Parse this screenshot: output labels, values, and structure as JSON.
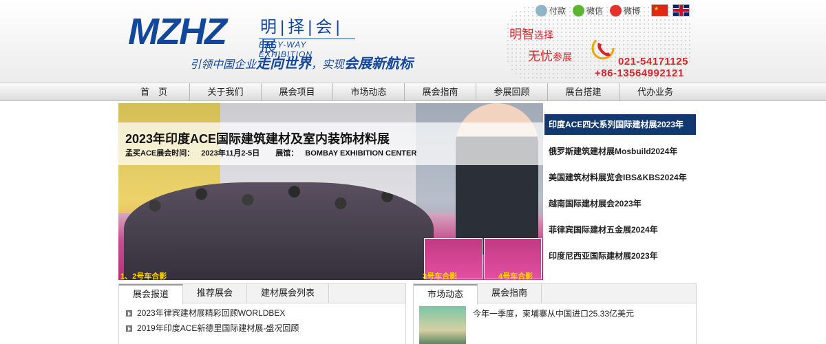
{
  "brand": {
    "logo_mark": "MZHZ",
    "logo_cn": "明|择|会|展",
    "logo_en": "EASY-WAY EXHIBITION",
    "slogan_prefix": "引领中国企业",
    "slogan_emph1": "走向世界",
    "slogan_mid": "，实现",
    "slogan_emph2": "会展新航标"
  },
  "top_links": {
    "pay": "付款",
    "wechat": "微信",
    "weibo": "微博"
  },
  "tagline": {
    "line1_big": "明智",
    "line1_small": "选择",
    "line2_big": "无忧",
    "line2_small": "参展"
  },
  "contact": {
    "phone1": "021-54171125",
    "phone2": "+86-13564992121"
  },
  "nav": [
    "首　页",
    "关于我们",
    "展会项目",
    "市场动态",
    "展会指南",
    "参展回顾",
    "展台搭建",
    "代办业务"
  ],
  "banner": {
    "title": "2023年印度ACE国际建筑建材及室内装饰材料展",
    "time_label": "孟买ACE展会时间：",
    "time_value": "2023年11月2-5日",
    "venue_label": "展馆：",
    "venue_value": "BOMBAY EXHIBITION CENTER",
    "caption1": "1、2号车合影",
    "caption2": "3号车合影",
    "caption3": "4号车合影"
  },
  "expo_list": [
    "印度ACE四大系列国际建材展2023年",
    "俄罗斯建筑建材展Mosbuild2024年",
    "美国建筑材料展览会IBS&KBS2024年",
    "越南国际建材展会2023年",
    "菲律宾国际建材五金展2024年",
    "印度尼西亚国际建材展2023年"
  ],
  "left_panel": {
    "tabs": [
      "展会报道",
      "推荐展会",
      "建材展会列表"
    ],
    "news": [
      "2023年律宾建材展精彩回顾WORLDBEX",
      "2019年印度ACE新德里国际建材展-盛况回顾"
    ]
  },
  "right_panel": {
    "tabs": [
      "市场动态",
      "展会指南"
    ],
    "news": [
      "今年一季度，柬埔寨从中国进口25.33亿美元"
    ]
  },
  "colors": {
    "brand_blue": "#12479c",
    "accent_red": "#d7262b",
    "nav_active": "#11386f"
  }
}
